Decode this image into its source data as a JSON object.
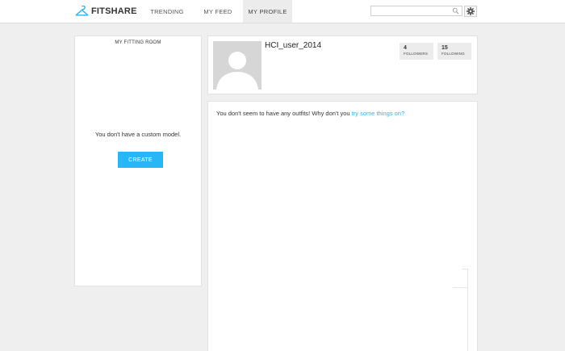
{
  "header": {
    "logo_text": "FITSHARE",
    "nav": {
      "trending": "TRENDING",
      "feed": "MY FEED",
      "profile": "MY PROFILE"
    },
    "search": {
      "placeholder": "",
      "value": ""
    },
    "icons": [
      "hanger-icon",
      "search-icon",
      "gear-icon"
    ]
  },
  "fitting_room": {
    "title": "MY FITTING ROOM",
    "message": "You don't have a custom model.",
    "create_label": "CREATE"
  },
  "profile": {
    "username": "HCI_user_2014",
    "followers": {
      "count": "4",
      "label": "FOLLOWERS"
    },
    "following": {
      "count": "15",
      "label": "FOLLOWING"
    }
  },
  "outfits": {
    "message": "You don't seem to have any outfits! Why don't you",
    "link": "try some things on?"
  },
  "colors": {
    "accent": "#29b6f6",
    "background": "#efefef",
    "panel": "#ffffff",
    "active_tab": "#ececec"
  }
}
